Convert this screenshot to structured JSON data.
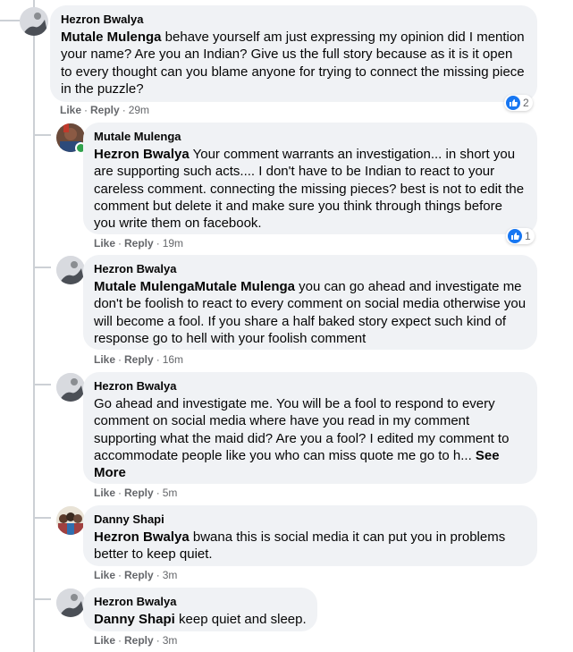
{
  "actions": {
    "like": "Like",
    "reply": "Reply",
    "separator": "·"
  },
  "comments": [
    {
      "author": "Hezron Bwalya",
      "mention": "Mutale Mulenga",
      "text": " behave yourself am just expressing my opinion did I mention your name? Are you an Indian? Give us the full story because as it is it open to every thought can you blame anyone for trying to connect the missing piece in the puzzle?",
      "time": "29m",
      "reactions": "2"
    },
    {
      "author": "Mutale Mulenga",
      "mention": "Hezron Bwalya",
      "text": " Your comment warrants an investigation... in short you are supporting such acts.... I don't have to be Indian to react to your careless comment. connecting the missing pieces? best is not to edit the comment but delete it and make sure you think through things before you write them on facebook.",
      "time": "19m",
      "reactions": "1"
    },
    {
      "author": "Hezron Bwalya",
      "mention": "Mutale MulengaMutale Mulenga",
      "text": " you can go ahead and investigate me don't be foolish to react to every comment on social media otherwise you will become a fool. If you share a half baked story expect such kind of response go to hell with your foolish comment",
      "time": "16m"
    },
    {
      "author": "Hezron Bwalya",
      "text": "Go ahead and investigate me. You will be a fool to respond to every comment on social media where have you read in my comment supporting what the maid did? Are you a fool? I edited my comment to accommodate people like you who can miss quote me go to h... ",
      "see_more": "See More",
      "time": "5m"
    },
    {
      "author": "Danny Shapi",
      "mention": "Hezron Bwalya",
      "text": " bwana this is social media it can put you in problems better to keep quiet.",
      "time": "3m"
    },
    {
      "author": "Hezron Bwalya",
      "mention": "Danny Shapi",
      "text": " keep quiet and sleep.",
      "time": "3m"
    }
  ],
  "colors": {
    "bubble": "#f0f2f5",
    "meta_text": "#65676b",
    "like_blue": "#1877f2",
    "thread_line": "#ccd0d5",
    "online": "#31a24c"
  }
}
